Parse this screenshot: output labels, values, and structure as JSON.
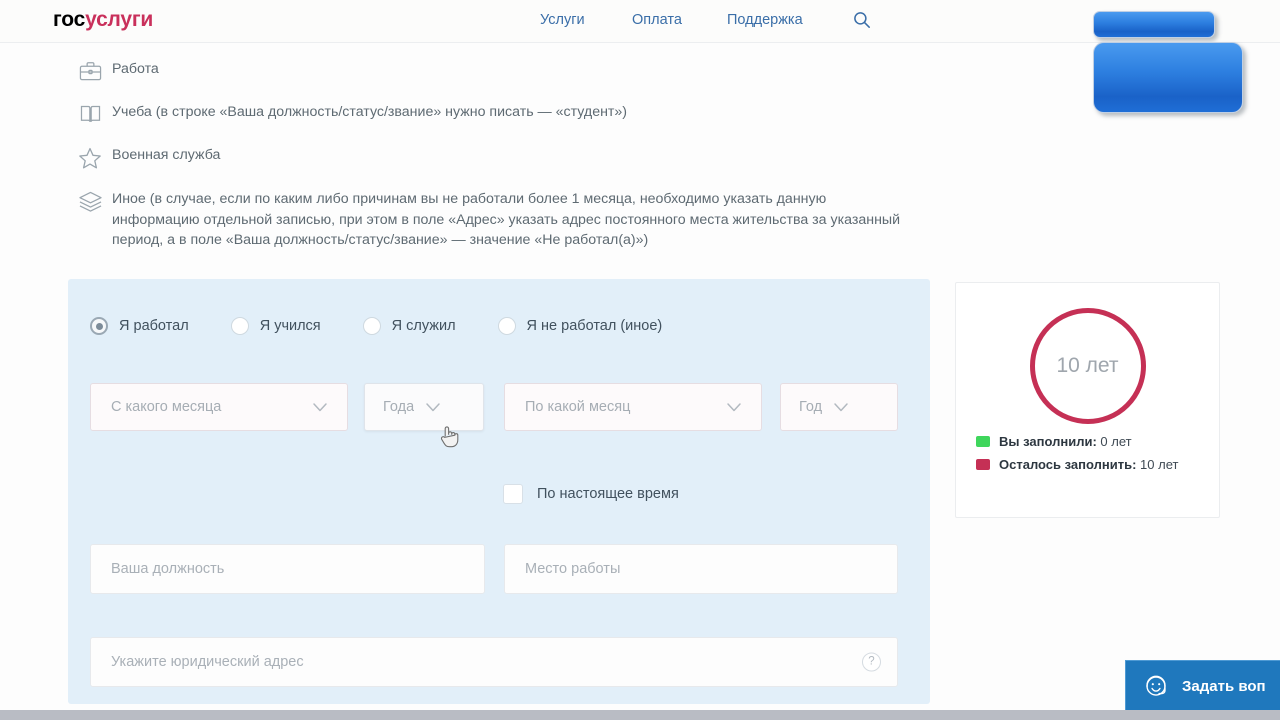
{
  "header": {
    "logo_gos": "гос",
    "logo_uslugi": "услуги",
    "nav": [
      {
        "label": "Услуги"
      },
      {
        "label": "Оплата"
      },
      {
        "label": "Поддержка"
      }
    ],
    "search_icon": "search-icon"
  },
  "info_list": [
    {
      "icon": "briefcase-icon",
      "text": "Работа"
    },
    {
      "icon": "book-icon",
      "text": "Учеба (в строке «Ваша должность/статус/звание» нужно писать — «студент»)"
    },
    {
      "icon": "star-icon",
      "text": "Военная служба"
    },
    {
      "icon": "layers-icon",
      "text": "Иное (в случае, если по каким либо причинам вы не работали более 1 месяца, необходимо указать данную информацию отдельной записью, при этом в поле «Адрес» указать адрес постоянного места жительства за указанный период, а в поле «Ваша должность/статус/звание» — значение «Не работал(а)»)"
    }
  ],
  "form": {
    "radios": [
      {
        "label": "Я работал",
        "checked": true
      },
      {
        "label": "Я учился",
        "checked": false
      },
      {
        "label": "Я служил",
        "checked": false
      },
      {
        "label": "Я не работал (иное)",
        "checked": false
      }
    ],
    "selects": [
      {
        "name": "month-from",
        "value": "",
        "placeholder": "С какого месяца"
      },
      {
        "name": "year-from",
        "value": "",
        "placeholder": "Года"
      },
      {
        "name": "month-to",
        "value": "",
        "placeholder": "По какой месяц"
      },
      {
        "name": "year-to",
        "value": "",
        "placeholder": "Год"
      }
    ],
    "checkbox": {
      "label": "По настоящее время",
      "checked": false
    },
    "inputs": [
      {
        "name": "position",
        "value": "",
        "placeholder": "Ваша должность"
      },
      {
        "name": "workplace",
        "value": "",
        "placeholder": "Место работы"
      },
      {
        "name": "address",
        "value": "",
        "placeholder": "Укажите юридический адрес",
        "help": "?"
      }
    ]
  },
  "progress": {
    "ring_label": "10 лет",
    "ring_color": "#c53055",
    "legend": [
      {
        "swatch": "green",
        "color": "#3fd65c",
        "label": "Вы заполнили:",
        "value": "0 лет"
      },
      {
        "swatch": "red",
        "color": "#c53055",
        "label": "Осталось заполнить:",
        "value": "10 лет"
      }
    ]
  },
  "chat": {
    "icon": "support-smiley-icon",
    "label": "Задать воп"
  }
}
